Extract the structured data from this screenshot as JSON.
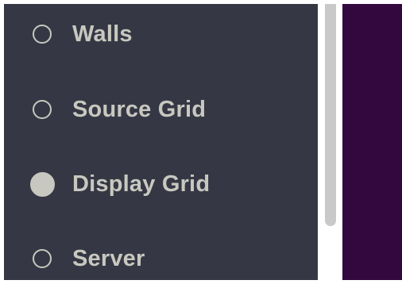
{
  "options": [
    {
      "label": "Walls",
      "checked": false
    },
    {
      "label": "Source Grid",
      "checked": false
    },
    {
      "label": "Display Grid",
      "checked": true
    },
    {
      "label": "Server",
      "checked": false
    }
  ],
  "colors": {
    "panel_bg": "#353844",
    "text": "#c8c8c0",
    "right_pane_bg": "#32083f",
    "scrollbar_thumb": "#c9c9c9"
  },
  "icons": {
    "radio_unchecked": "radio-unchecked-icon",
    "radio_checked": "radio-checked-icon"
  }
}
